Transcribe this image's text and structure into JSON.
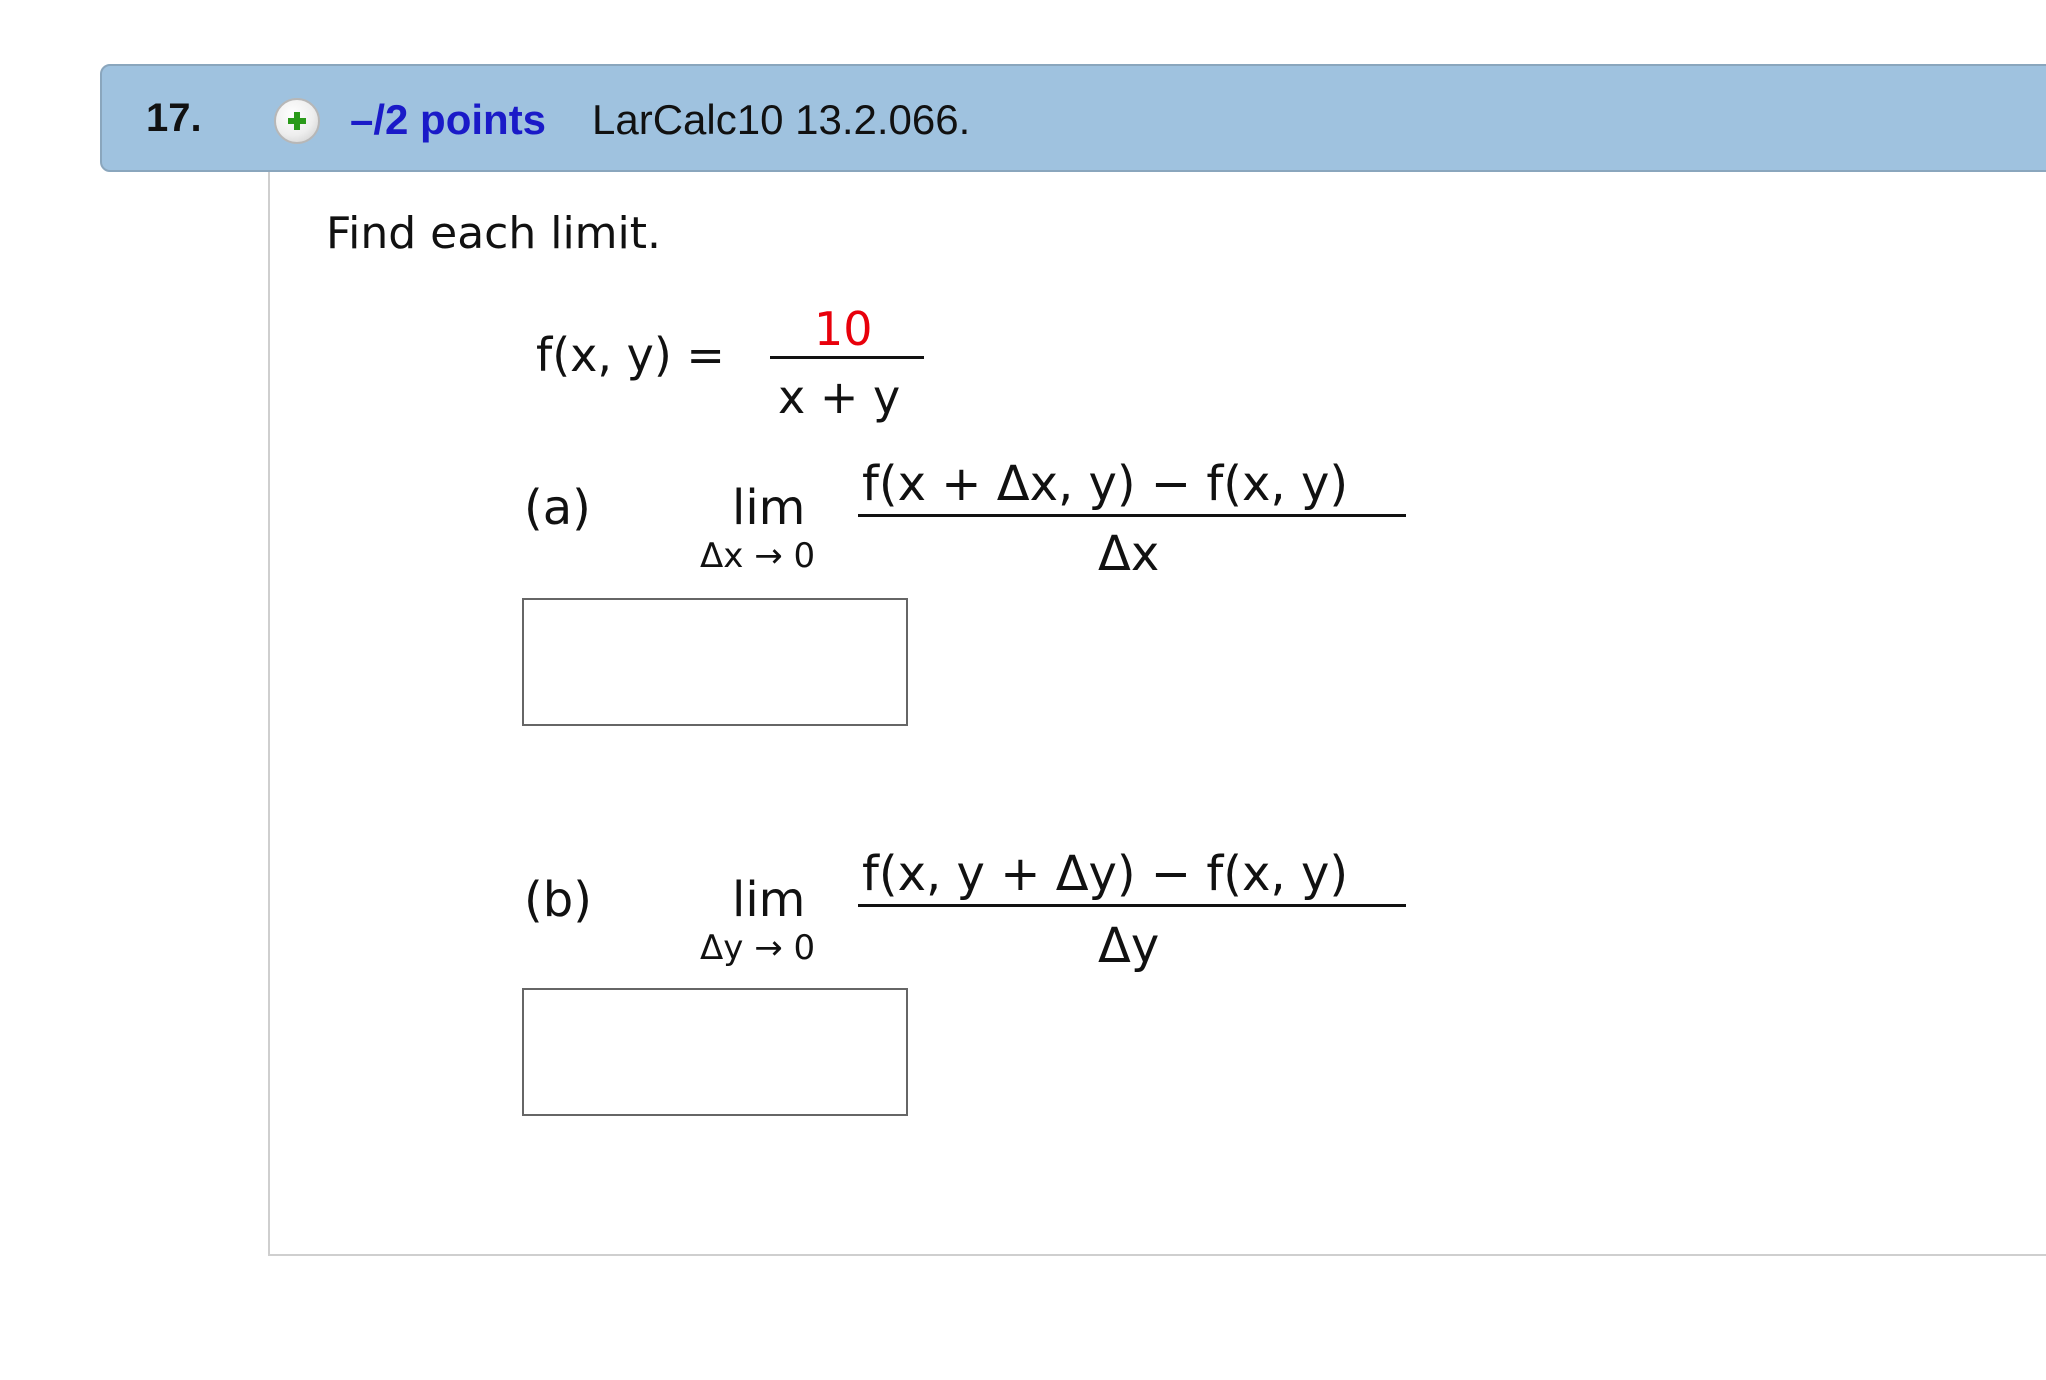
{
  "header": {
    "question_number": "17.",
    "points": "–/2 points",
    "source": "LarCalc10 13.2.066."
  },
  "problem": {
    "instruction": "Find each limit.",
    "function": {
      "lhs": "f(x, y) =",
      "numerator": "10",
      "denominator": "x + y"
    },
    "parts": [
      {
        "label": "(a)",
        "lim": "lim",
        "lim_sub": "Δx → 0",
        "numerator": "f(x + Δx, y) − f(x, y)",
        "denominator": "Δx",
        "answer": ""
      },
      {
        "label": "(b)",
        "lim": "lim",
        "lim_sub": "Δy → 0",
        "numerator": "f(x, y + Δy) − f(x, y)",
        "denominator": "Δy",
        "answer": ""
      }
    ]
  },
  "colors": {
    "header_bg": "#9fc2df",
    "points_color": "#1a1ac8",
    "highlight_number": "#e8000b"
  }
}
